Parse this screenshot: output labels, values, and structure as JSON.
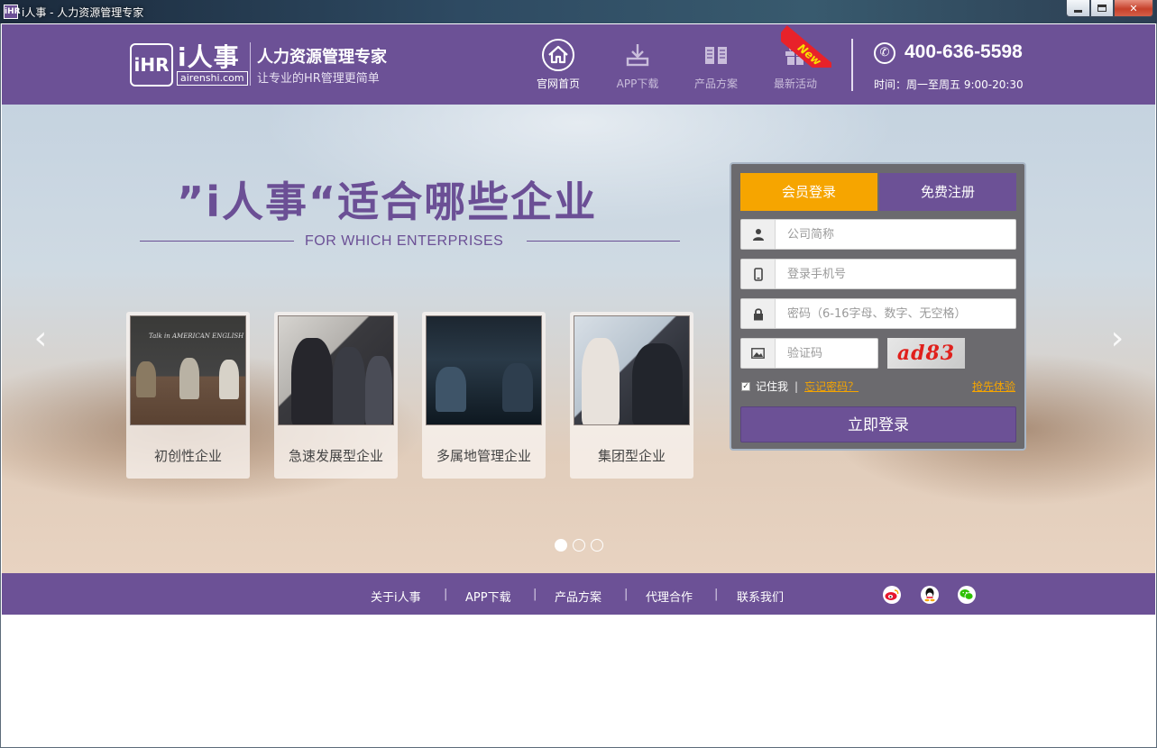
{
  "window": {
    "title": "i人事 - 人力资源管理专家",
    "app_icon": "iHR"
  },
  "header": {
    "logo_mark": "iHR",
    "logo_text": "i人事",
    "logo_url": "airenshi.com",
    "slogan_main": "人力资源管理专家",
    "slogan_sub": "让专业的HR管理更简单",
    "nav": [
      {
        "label": "官网首页",
        "icon": "home-icon",
        "active": true
      },
      {
        "label": "APP下载",
        "icon": "download-icon",
        "active": false
      },
      {
        "label": "产品方案",
        "icon": "book-icon",
        "active": false
      },
      {
        "label": "最新活动",
        "icon": "gift-icon",
        "active": false
      }
    ],
    "new_badge": "New",
    "phone": "400-636-5598",
    "hours": "时间：周一至周五   9:00-20:30"
  },
  "banner": {
    "title": "”i人事“适合哪些企业",
    "subtitle": "FOR WHICH ENTERPRISES",
    "board_text": "Talk in AMERICAN ENGLISH",
    "cards": [
      {
        "label": "初创性企业"
      },
      {
        "label": "急速发展型企业"
      },
      {
        "label": "多属地管理企业"
      },
      {
        "label": "集团型企业"
      }
    ],
    "slide_index": 1,
    "slide_count": 3
  },
  "login": {
    "tab_login": "会员登录",
    "tab_register": "免费注册",
    "company_placeholder": "公司简称",
    "phone_placeholder": "登录手机号",
    "password_placeholder": "密码（6-16字母、数字、无空格）",
    "captcha_placeholder": "验证码",
    "captcha_text": "ad83",
    "remember_label": "记住我",
    "forgot_label": "忘记密码？",
    "try_label": "抢先体验",
    "submit_label": "立即登录"
  },
  "footer": {
    "links": [
      "关于i人事",
      "APP下载",
      "产品方案",
      "代理合作",
      "联系我们"
    ],
    "social": [
      "weibo-icon",
      "qq-icon",
      "wechat-icon"
    ]
  },
  "colors": {
    "brand_purple": "#6c5196",
    "accent_orange": "#f6a500"
  }
}
